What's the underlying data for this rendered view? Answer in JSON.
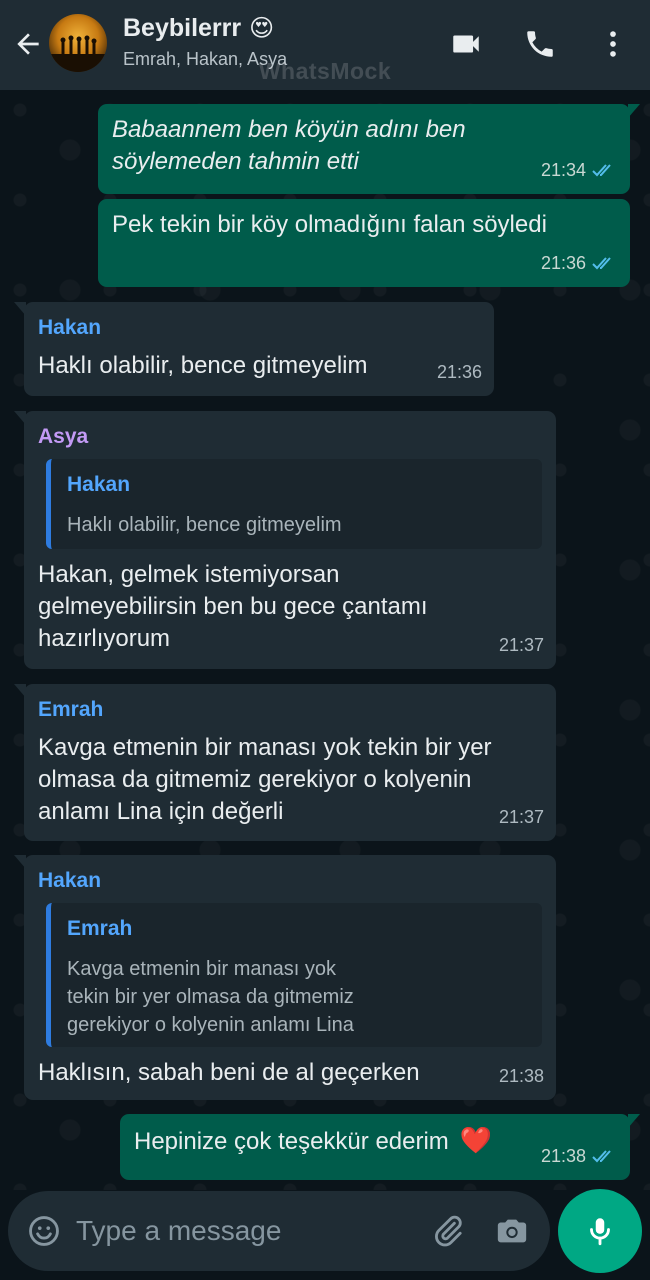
{
  "header": {
    "title": "Beybilerrr",
    "title_emoji": "😍",
    "subtitle": "Emrah, Hakan, Asya",
    "watermark": "WhatsMock",
    "icons": [
      "back-arrow-icon",
      "video-call-icon",
      "phone-icon",
      "more-vert-icon"
    ]
  },
  "colors": {
    "outgoing": "#005c4b",
    "incoming": "#1f2c34",
    "hakan": "#53a6fd",
    "asya": "#c39af5",
    "emrah": "#53a6fd",
    "ticks": "#53bdeb",
    "mic": "#00a884"
  },
  "messages": [
    {
      "type": "out",
      "text_line1": "Babaannem ben köyün adını ben",
      "text_line2": "söylemeden tahmin etti",
      "time": "21:34"
    },
    {
      "type": "out",
      "text": "Pek tekin bir köy olmadığını falan söyledi",
      "time": "21:36"
    },
    {
      "type": "in",
      "sender": "Hakan",
      "text": "Haklı olabilir, bence gitmeyelim",
      "time": "21:36"
    },
    {
      "type": "in",
      "sender": "Asya",
      "quote_name": "Hakan",
      "quote_text": "Haklı olabilir, bence gitmeyelim",
      "text_line1": "Hakan, gelmek istemiyorsan",
      "text_line2": "gelmeyebilirsin ben bu gece çantamı",
      "text_line3": "hazırlıyorum",
      "time": "21:37"
    },
    {
      "type": "in",
      "sender": "Emrah",
      "text_line1": "Kavga etmenin bir manası yok tekin bir yer",
      "text_line2": "olmasa da gitmemiz gerekiyor o kolyenin",
      "text_line3": "anlamı Lina için değerli",
      "time": "21:37"
    },
    {
      "type": "in",
      "sender": "Hakan",
      "quote_name": "Emrah",
      "quote_line1": "Kavga etmenin bir manası yok",
      "quote_line2": "tekin bir yer olmasa da gitmemiz",
      "quote_line3": "gerekiyor o kolyenin anlamı Lina",
      "text": "Haklısın, sabah beni de al geçerken",
      "time": "21:38"
    },
    {
      "type": "out",
      "text": "Hepinize çok teşekkür ederim",
      "emoji": "❤️",
      "time": "21:38"
    }
  ],
  "composer": {
    "placeholder": "Type a message",
    "icons": [
      "emoji-icon",
      "attach-icon",
      "camera-icon",
      "mic-icon"
    ]
  }
}
